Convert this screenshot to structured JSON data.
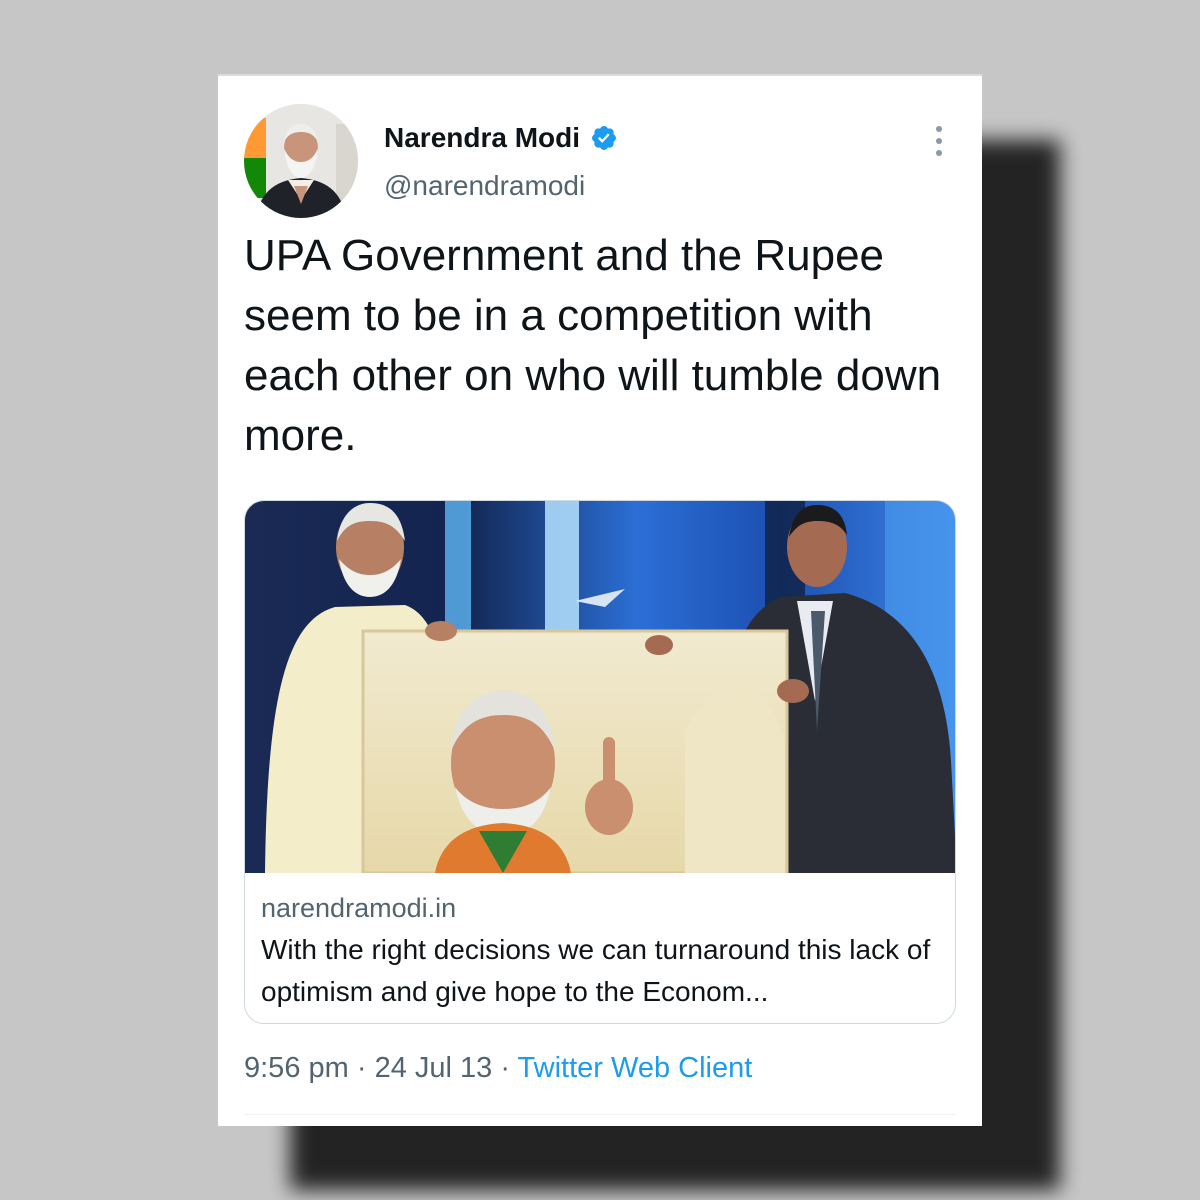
{
  "tweet": {
    "author": {
      "name": "Narendra Modi",
      "handle": "@narendramodi",
      "verified": true,
      "verified_color": "#1d9bf0"
    },
    "text": "UPA Government and the Rupee seem to be in a competition with each other on who will tumble down more.",
    "link_card": {
      "domain": "narendramodi.in",
      "description": "With the right decisions we can turnaround this lack of optimism and give hope to the Econom..."
    },
    "time": "9:56 pm",
    "date": "24 Jul 13",
    "source": "Twitter Web Client",
    "separator": " · "
  },
  "icons": {
    "verified": "verified-badge-icon",
    "more": "more-options-icon"
  },
  "colors": {
    "text_primary": "#0f1419",
    "text_secondary": "#536471",
    "link": "#1d9bf0",
    "border": "#cfd9de"
  }
}
